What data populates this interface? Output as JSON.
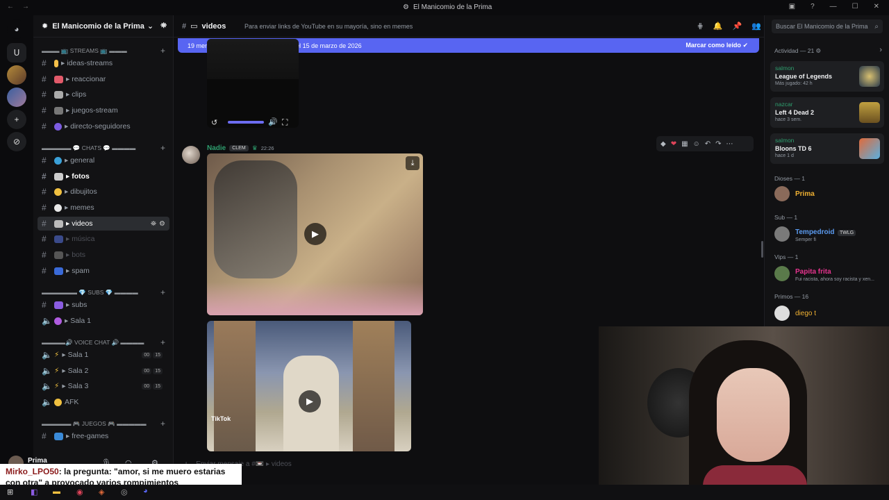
{
  "window": {
    "title": "El Manicomio de la Prima"
  },
  "server": {
    "name": "El Manicomio de la Prima"
  },
  "sidebar": {
    "categories": {
      "streams": "▬▬▬ 📺 STREAMS 📺 ▬▬▬",
      "chats": "▬▬▬▬▬ 💬 CHATS 💬 ▬▬▬▬",
      "subs": "▬▬▬▬▬▬ 💎 SUBS 💎 ▬▬▬▬",
      "voice": "▬▬▬▬🔊 VOICE CHAT 🔊 ▬▬▬▬",
      "juegos": "▬▬▬▬▬ 🎮 JUEGOS 🎮 ▬▬▬▬▬"
    },
    "channels": {
      "ideas_streams": "ideas-streams",
      "reaccionar": "reaccionar",
      "clips": "clips",
      "juegos_stream": "juegos-stream",
      "directo_seguidores": "directo-seguidores",
      "general": "general",
      "fotos": "fotos",
      "dibujitos": "dibujitos",
      "memes": "memes",
      "videos": "videos",
      "musica": "música",
      "bots": "bots",
      "spam": "spam",
      "subs": "subs",
      "sala1_subs": "Sala 1",
      "sala1": "Sala 1",
      "sala2": "Sala 2",
      "sala3": "Sala 3",
      "afk": "AFK",
      "free_games": "free-games"
    },
    "voice_counts": {
      "a": "00",
      "b": "15"
    }
  },
  "user_panel": {
    "name": "Prima"
  },
  "chat": {
    "channel": "videos",
    "topic": "Para enviar links de YouTube en su mayoría, sino en memes",
    "new_messages_banner": "19 mensajes nuevos desde las 22:35 del 15 de marzo de 2026",
    "mark_read": "Marcar como leído",
    "message": {
      "author": "Nadie",
      "badge": "CLEM",
      "time": "22:26"
    },
    "tiktok_label": "TikTok",
    "composer_placeholder": "Enviar mensaje a #📼 ▸ videos"
  },
  "members": {
    "search_placeholder": "Buscar El Manicomio de la Prima",
    "activity_header": "Actividad — 21",
    "activities": [
      {
        "user": "salmon",
        "game": "League of Legends",
        "time": "Más jugado: 42 h"
      },
      {
        "user": "nazcar",
        "game": "Left 4 Dead 2",
        "time": "hace 3 sem."
      },
      {
        "user": "salmon",
        "game": "Bloons TD 6",
        "time": "hace 1 d"
      }
    ],
    "groups": {
      "dioses": "Dioses — 1",
      "sub": "Sub — 1",
      "vips": "Vips — 1",
      "primos": "Primos — 16"
    },
    "people": {
      "prima": "Prima",
      "tempedroid": "Tempedroid",
      "tempedroid_tag": "TWLG",
      "tempedroid_status": "Semper fi",
      "papita": "Papita frita",
      "papita_status": "Fui racista, ahora soy racista y xen...",
      "diego": "diego t"
    },
    "colors": {
      "prima": "#f0b132",
      "tempedroid": "#5b9bf0",
      "papita": "#e6348f",
      "diego": "#f0b132"
    }
  },
  "overlay": {
    "user": "Mirko_LPO50",
    "text": ": la pregunta: \"amor, si me muero estarias con otra\" a provocado varios rompimientos"
  }
}
